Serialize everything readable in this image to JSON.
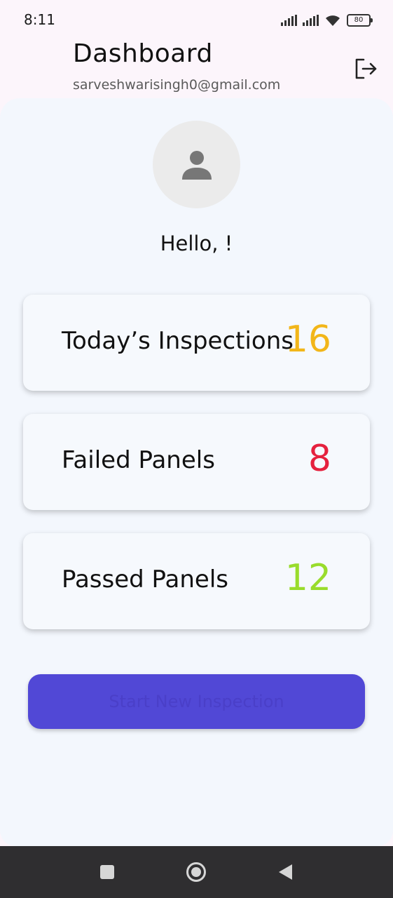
{
  "status_bar": {
    "time": "8:11",
    "battery": "80",
    "icons": [
      "signal-icon",
      "signal-icon",
      "wifi-icon",
      "battery-icon"
    ]
  },
  "header": {
    "title": "Dashboard",
    "email": "sarveshwarisingh0@gmail.com",
    "logout_icon": "logout-icon"
  },
  "profile": {
    "avatar_icon": "person-icon",
    "greeting": "Hello, !"
  },
  "stats": [
    {
      "label": "Today’s Inspections",
      "value": "16",
      "color": "#f2b619"
    },
    {
      "label": "Failed Panels",
      "value": "8",
      "color": "#e5213e"
    },
    {
      "label": "Passed Panels",
      "value": "12",
      "color": "#99dc2c"
    }
  ],
  "actions": {
    "start_label": "Start New Inspection",
    "button_color": "#5148d6"
  },
  "nav": {
    "icons": [
      "recents-icon",
      "home-icon",
      "back-icon"
    ]
  }
}
